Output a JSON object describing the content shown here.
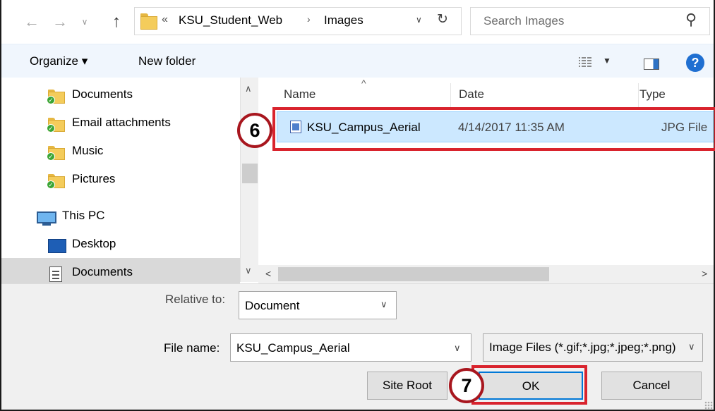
{
  "address": {
    "path_chevron": "«",
    "path_segments": [
      "KSU_Student_Web",
      "Images"
    ],
    "search_placeholder": "Search Images"
  },
  "toolbar": {
    "organize_label": "Organize ▾",
    "new_folder_label": "New folder",
    "help_label": "?"
  },
  "nav": {
    "items": [
      {
        "label": "Documents"
      },
      {
        "label": "Email attachments"
      },
      {
        "label": "Music"
      },
      {
        "label": "Pictures"
      },
      {
        "label": "This PC"
      },
      {
        "label": "Desktop"
      },
      {
        "label": "Documents"
      }
    ]
  },
  "files": {
    "columns": [
      "Name",
      "Date",
      "Type"
    ],
    "rows": [
      {
        "name": "KSU_Campus_Aerial",
        "date": "4/14/2017 11:35 AM",
        "type": "JPG File"
      }
    ]
  },
  "bottom": {
    "relative_label": "Relative to:",
    "relative_value": "Document",
    "filename_label": "File name:",
    "filename_value": "KSU_Campus_Aerial",
    "filetype_value": "Image Files (*.gif;*.jpg;*.jpeg;*.png)",
    "site_root_label": "Site Root",
    "ok_label": "OK",
    "cancel_label": "Cancel"
  },
  "annotations": {
    "step_6": "6",
    "step_7": "7"
  },
  "colors": {
    "highlight_red": "#d9232d",
    "selection_blue": "#cce8ff",
    "ok_border": "#0078d7"
  }
}
